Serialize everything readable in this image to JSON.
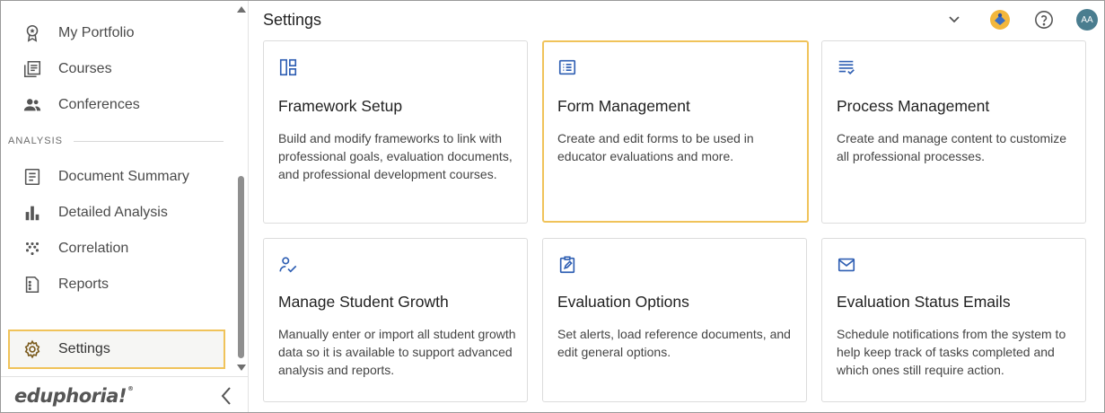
{
  "sidebar": {
    "items_top": [
      {
        "label": "My Portfolio",
        "icon": "award-icon"
      },
      {
        "label": "Courses",
        "icon": "courses-icon"
      },
      {
        "label": "Conferences",
        "icon": "people-icon"
      }
    ],
    "section_label": "ANALYSIS",
    "items_analysis": [
      {
        "label": "Document Summary",
        "icon": "document-icon"
      },
      {
        "label": "Detailed Analysis",
        "icon": "bar-chart-icon"
      },
      {
        "label": "Correlation",
        "icon": "scatter-icon"
      },
      {
        "label": "Reports",
        "icon": "report-icon"
      }
    ],
    "active_item": {
      "label": "Settings",
      "icon": "gear-icon"
    },
    "logo_text": "eduphoria!",
    "logo_mark": "®"
  },
  "header": {
    "title": "Settings",
    "avatar_initials": "AA"
  },
  "cards": [
    {
      "title": "Framework Setup",
      "description": "Build and modify frameworks to link with professional goals, evaluation documents, and professional development courses.",
      "icon": "dashboard-layout-icon"
    },
    {
      "title": "Form Management",
      "description": "Create and edit forms to be used in educator evaluations and more.",
      "icon": "list-form-icon"
    },
    {
      "title": "Process Management",
      "description": "Create and manage content to customize all professional processes.",
      "icon": "checklist-icon"
    },
    {
      "title": "Manage Student Growth",
      "description": "Manually enter or import all student growth data so it is available to support advanced analysis and reports.",
      "icon": "person-check-icon"
    },
    {
      "title": "Evaluation Options",
      "description": "Set alerts, load reference documents, and edit general options.",
      "icon": "clipboard-edit-icon"
    },
    {
      "title": "Evaluation Status Emails",
      "description": "Schedule notifications from the system to help keep track of tasks completed and which ones still require action.",
      "icon": "mail-icon"
    }
  ],
  "colors": {
    "accent_icon": "#2f5fb3",
    "highlight_border": "#f0c35a",
    "avatar_bg": "#4a7d8f"
  }
}
